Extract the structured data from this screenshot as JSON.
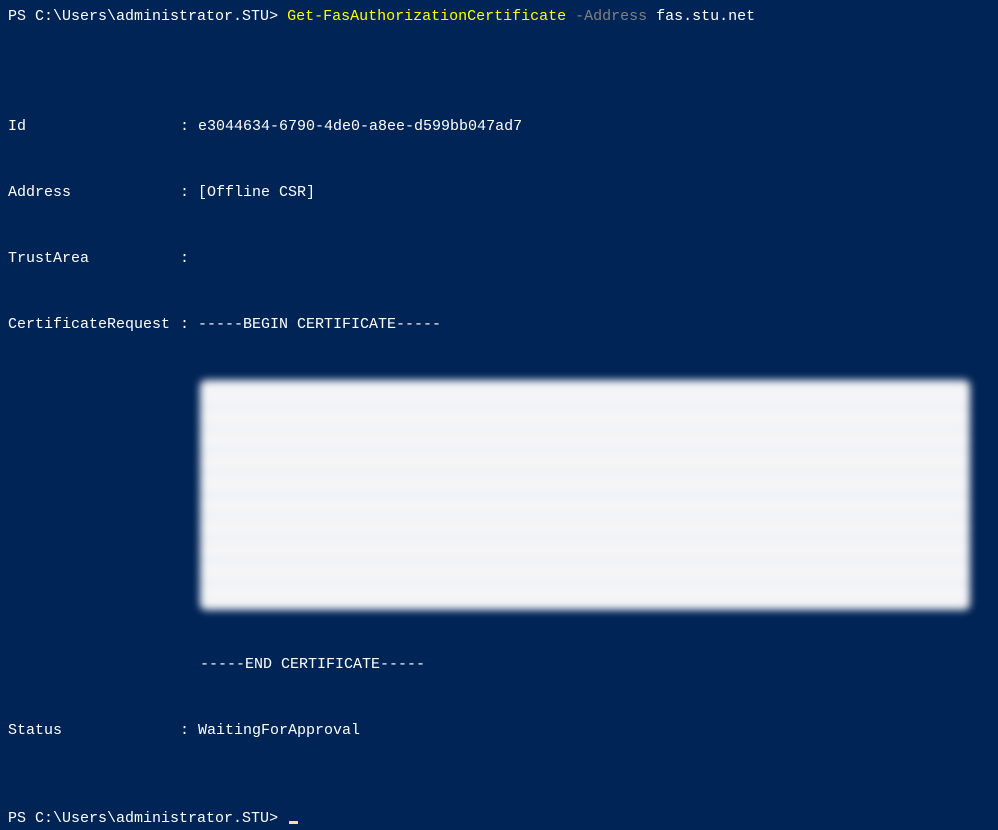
{
  "prompt1": {
    "ps": "PS ",
    "path": "C:\\Users\\administrator.STU",
    "arrow": "> ",
    "command": "Get-FasAuthorizationCertificate",
    "param_name": " -Address ",
    "param_value": "fas.stu.net"
  },
  "output": {
    "rows": [
      {
        "label": "Id",
        "value": "e3044634-6790-4de0-a8ee-d599bb047ad7"
      },
      {
        "label": "Address",
        "value": "[Offline CSR]"
      },
      {
        "label": "TrustArea",
        "value": ""
      },
      {
        "label": "CertificateRequest",
        "value": "-----BEGIN CERTIFICATE-----"
      }
    ],
    "end_cert": "-----END CERTIFICATE-----",
    "status": {
      "label": "Status",
      "value": "WaitingForApproval"
    }
  },
  "prompt2": {
    "ps": "PS ",
    "path": "C:\\Users\\administrator.STU",
    "arrow": "> "
  }
}
